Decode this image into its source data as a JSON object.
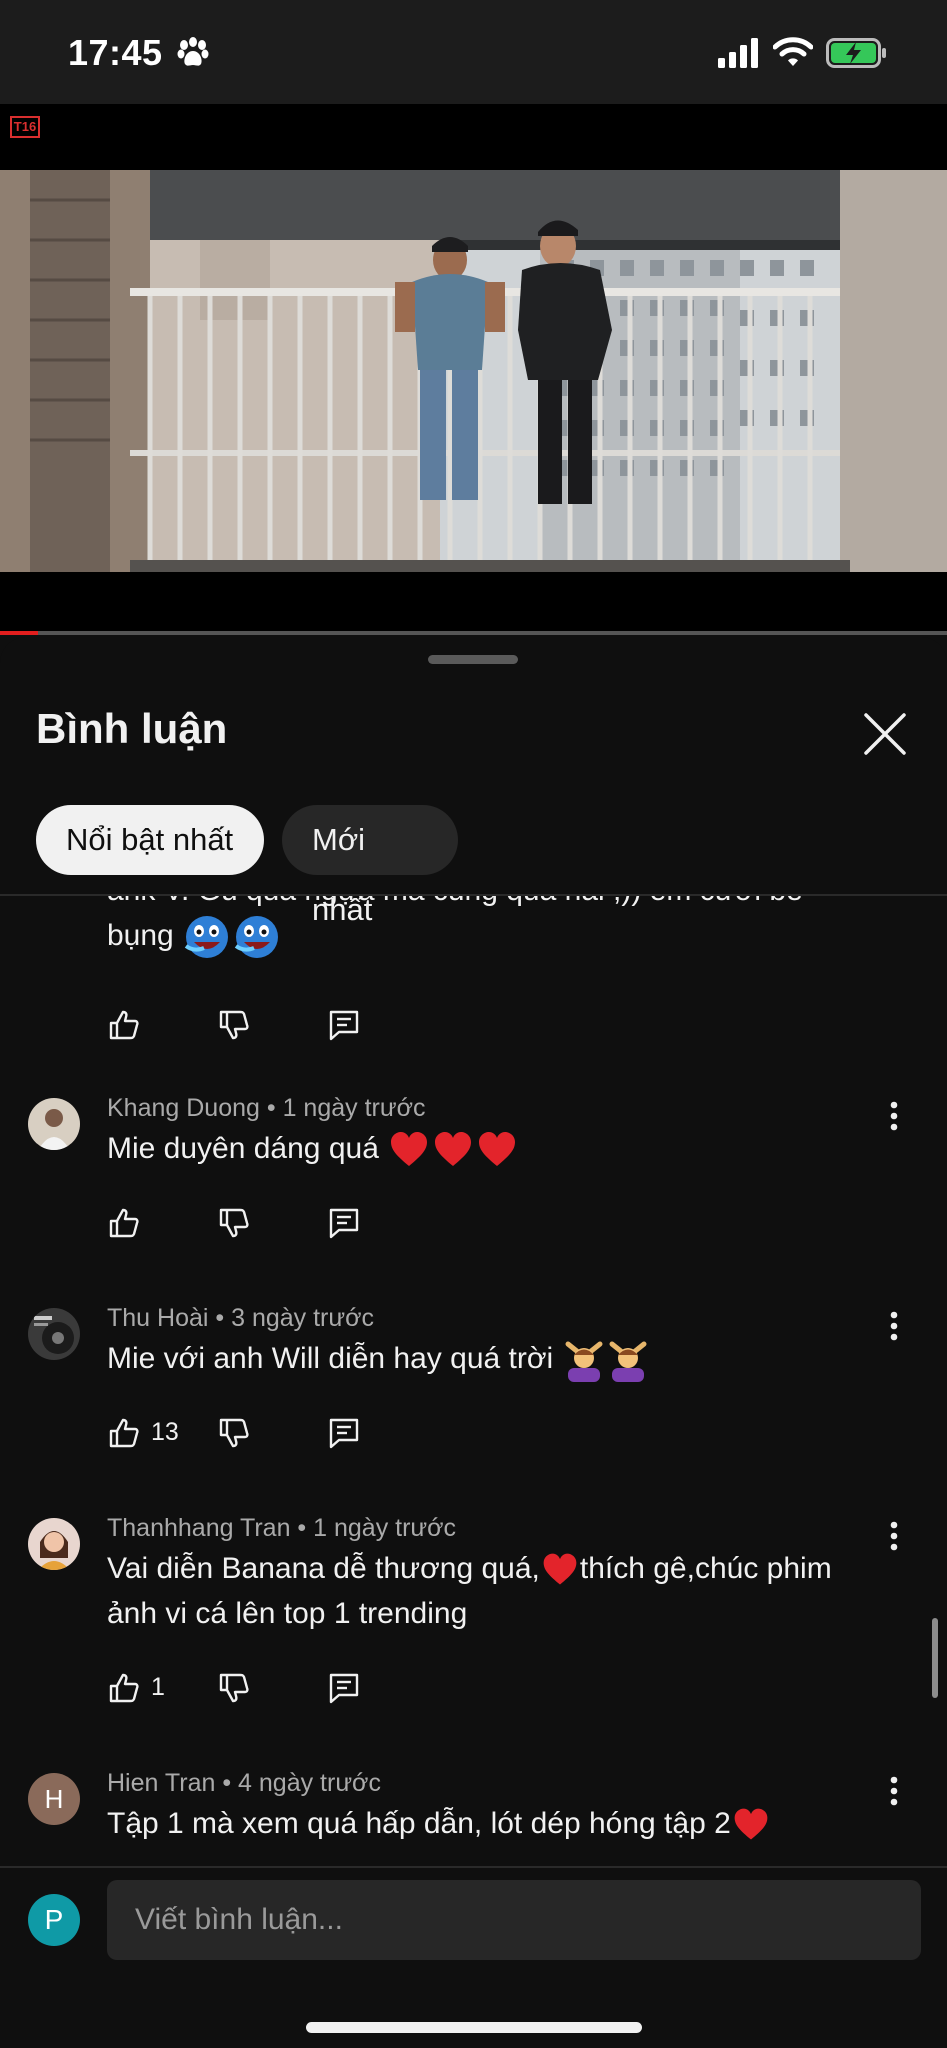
{
  "status_bar": {
    "time": "17:45",
    "battery_charging": true
  },
  "video": {
    "rating_badge": "T16",
    "progress_fraction": 0.04,
    "accent": "#e21e1e"
  },
  "sheet": {
    "title": "Bình luận",
    "sort_chips": [
      {
        "label": "Nổi bật nhất",
        "selected": true
      },
      {
        "label": "Mới nhất",
        "selected": false
      }
    ]
  },
  "comments": {
    "partial": {
      "text_cut": "ank V. Gu quá ngựa mà cũng quá hài ;)) em cười bể",
      "text_end": "bụng"
    },
    "items": [
      {
        "author": "Khang Duong",
        "time": "1 ngày trước",
        "text": "Mie duyên dáng quá ",
        "likes": "",
        "emoji": "heart-x3"
      },
      {
        "author": "Thu Hoài",
        "time": "3 ngày trước",
        "text": "Mie với anh Will diễn hay quá trời ",
        "likes": "13",
        "emoji": "person-gesture-x2"
      },
      {
        "author": "Thanhhang Tran",
        "time": "1 ngày trước",
        "text_before": "Vai diễn Banana dễ thương quá,",
        "text_after": "thích gê,chúc phim ảnh vi cá lên top 1 trending",
        "likes": "1",
        "emoji": "heart"
      },
      {
        "author": "Hien Tran",
        "time": "4 ngày trước",
        "text": "Tập 1 mà xem quá hấp dẫn, lót dép hóng tập 2",
        "likes": "",
        "initial": "H",
        "emoji": "heart"
      }
    ],
    "separator": " • "
  },
  "composer": {
    "placeholder": "Viết bình luận...",
    "user_initial": "P",
    "avatar_color": "#0f9aa6"
  }
}
